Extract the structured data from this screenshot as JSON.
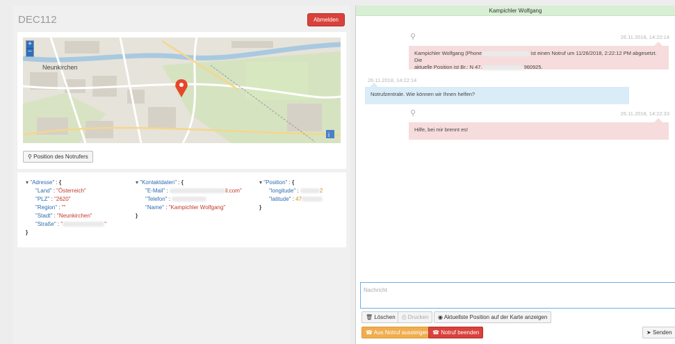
{
  "device": {
    "title": "DEC112",
    "logout_label": "Abmelden"
  },
  "map": {
    "zoom_in": "+",
    "zoom_out": "−",
    "city_label": "Neunkirchen",
    "position_button": "Position des Notrufers"
  },
  "json_view": {
    "adresse": {
      "key": "\"Adresse\"",
      "land_k": "\"Land\"",
      "land_v": "\"Österreich\"",
      "plz_k": "\"PLZ\"",
      "plz_v": "\"2620\"",
      "region_k": "\"Region\"",
      "region_v": "\"\"",
      "stadt_k": "\"Stadt\"",
      "stadt_v": "\"Neunkirchen\"",
      "strasse_k": "\"Straße\""
    },
    "kontakt": {
      "key": "\"Kontaktdaten\"",
      "email_k": "\"E-Mail\"",
      "email_v_tail": "il.com\"",
      "telefon_k": "\"Telefon\"",
      "name_k": "\"Name\"",
      "name_v": "\"Kampichler Wolfgang\""
    },
    "position": {
      "key": "\"Position\"",
      "lon_k": "\"longitude\"",
      "lon_v_tail": "2",
      "lat_k": "\"latitude\"",
      "lat_v_head": "47"
    }
  },
  "chat": {
    "title": "Kampichler Wolfgang",
    "messages": [
      {
        "ts": "26.11.2018, 14:22:14",
        "text_a": "Kampichler Wolfgang (Phone",
        "text_b": "ist einen Notruf um 11/26/2018, 2:22:12 PM abgesetzt. Die",
        "text_c": "aktuelle Position ist Br.: N 47.",
        "text_d": "960925."
      },
      {
        "ts": "26.11.2018, 14:22:14",
        "text": "Notrufzentrale. Wie können wir Ihnen helfen?"
      },
      {
        "ts": "26.11.2018, 14:22:33",
        "text": "Hilfe, bei mir brennt es!"
      }
    ],
    "compose_placeholder": "Nachricht",
    "buttons": {
      "delete": "Löschen",
      "print": "Drucken",
      "show_position": "Aktuellste Position auf der Karte anzeigen",
      "leave": "Aus Notruf aussteigen",
      "end": "Notruf beenden",
      "send": "Senden"
    }
  }
}
